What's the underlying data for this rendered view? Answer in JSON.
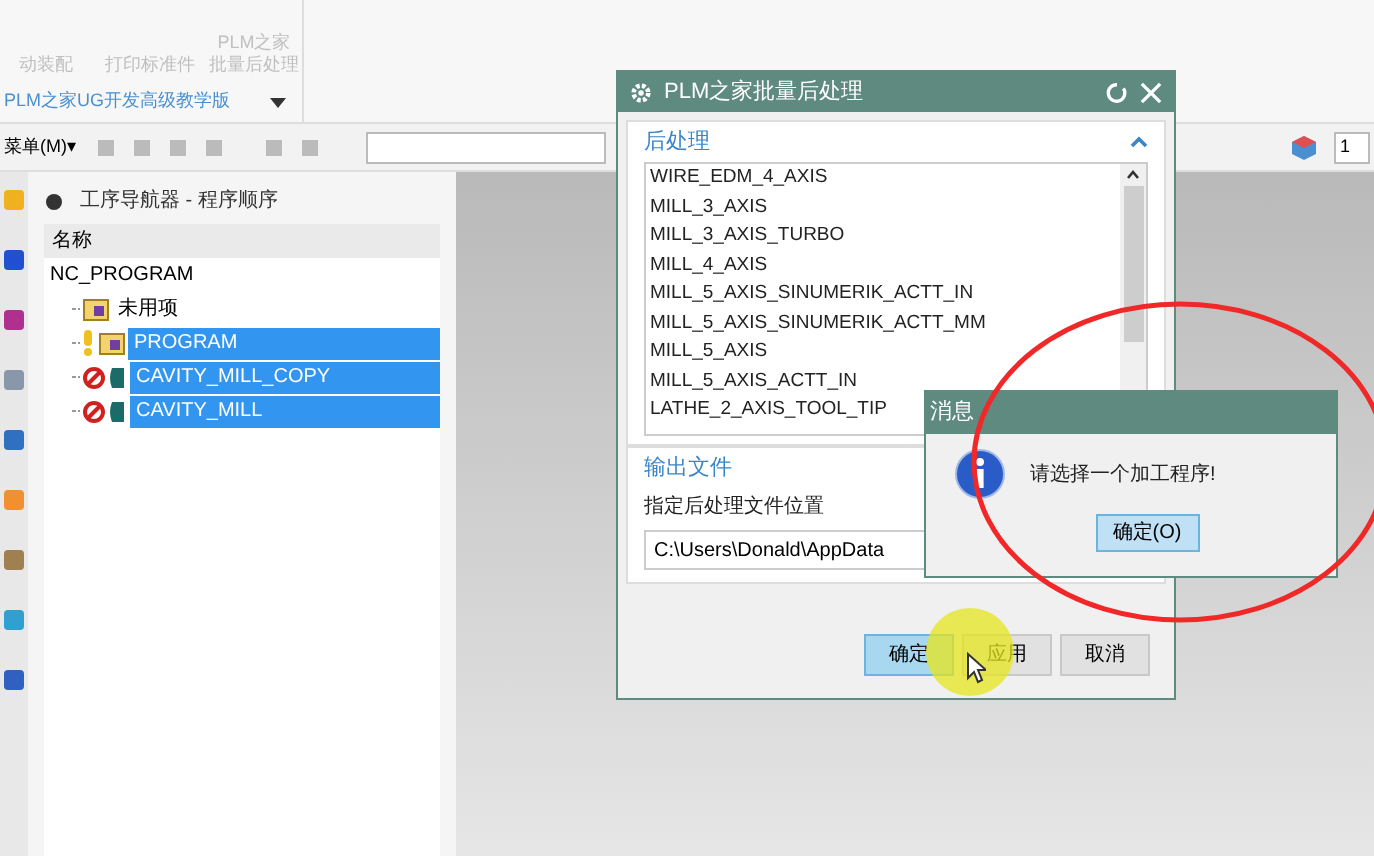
{
  "ribbon": {
    "buttons": [
      {
        "lines": [
          "动装配"
        ]
      },
      {
        "lines": [
          "打印标准件"
        ]
      },
      {
        "lines": [
          "PLM之家",
          "批量后处理"
        ]
      }
    ],
    "group_label": "PLM之家UG开发高级教学版"
  },
  "toolbar": {
    "menu": "菜单(M)▾",
    "field_value": "1"
  },
  "navigator": {
    "title": "工序导航器 - 程序顺序",
    "column": "名称",
    "tree": {
      "label": "NC_PROGRAM",
      "children": [
        {
          "label": "未用项",
          "kind": "folder",
          "selected": false
        },
        {
          "label": "PROGRAM",
          "kind": "warning",
          "selected": true
        },
        {
          "label": "CAVITY_MILL_COPY",
          "kind": "error",
          "selected": true
        },
        {
          "label": "CAVITY_MILL",
          "kind": "error",
          "selected": true
        }
      ]
    }
  },
  "dialog": {
    "title": "PLM之家批量后处理",
    "section_post": "后处理",
    "postprocessors": [
      "WIRE_EDM_4_AXIS",
      "MILL_3_AXIS",
      "MILL_3_AXIS_TURBO",
      "MILL_4_AXIS",
      "MILL_5_AXIS_SINUMERIK_ACTT_IN",
      "MILL_5_AXIS_SINUMERIK_ACTT_MM",
      "MILL_5_AXIS",
      "MILL_5_AXIS_ACTT_IN",
      "LATHE_2_AXIS_TOOL_TIP"
    ],
    "section_output": "输出文件",
    "output_label": "指定后处理文件位置",
    "output_value": "C:\\Users\\Donald\\AppData",
    "buttons": [
      {
        "label": "确定",
        "selected": true
      },
      {
        "label": "应用",
        "selected": false
      },
      {
        "label": "取消",
        "selected": false
      }
    ]
  },
  "message": {
    "title": "消息",
    "text": "请选择一个加工程序!",
    "button": "确定(O)"
  }
}
